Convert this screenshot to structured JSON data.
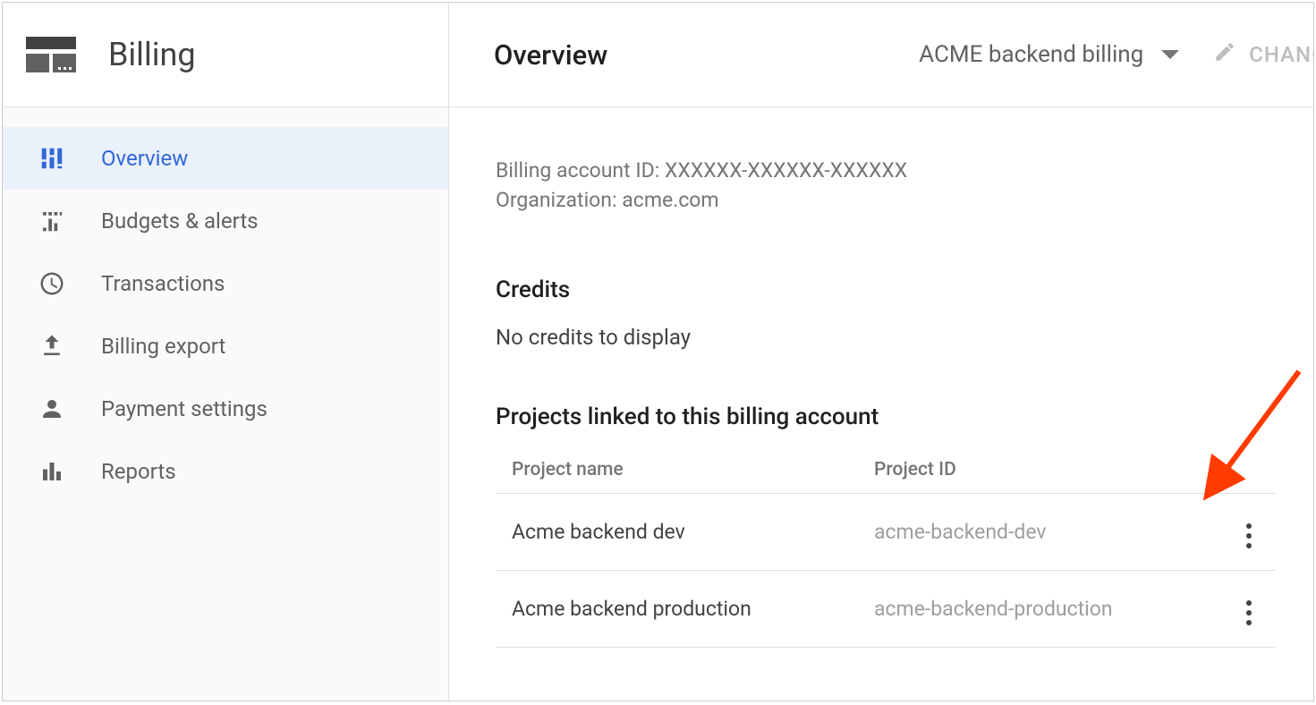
{
  "header": {
    "section_title": "Billing",
    "page_title": "Overview",
    "account_name": "ACME backend billing",
    "change_label": "CHANGE"
  },
  "sidebar": {
    "items": [
      {
        "label": "Overview"
      },
      {
        "label": "Budgets & alerts"
      },
      {
        "label": "Transactions"
      },
      {
        "label": "Billing export"
      },
      {
        "label": "Payment settings"
      },
      {
        "label": "Reports"
      }
    ]
  },
  "account_info": {
    "id_label": "Billing account ID:",
    "id_value": "XXXXXX-XXXXXX-XXXXXX",
    "org_label": "Organization:",
    "org_value": "acme.com"
  },
  "credits": {
    "heading": "Credits",
    "empty_msg": "No credits to display"
  },
  "projects": {
    "heading": "Projects linked to this billing account",
    "columns": {
      "name": "Project name",
      "id": "Project ID"
    },
    "rows": [
      {
        "name": "Acme backend dev",
        "id": "acme-backend-dev"
      },
      {
        "name": "Acme backend production",
        "id": "acme-backend-production"
      }
    ]
  }
}
